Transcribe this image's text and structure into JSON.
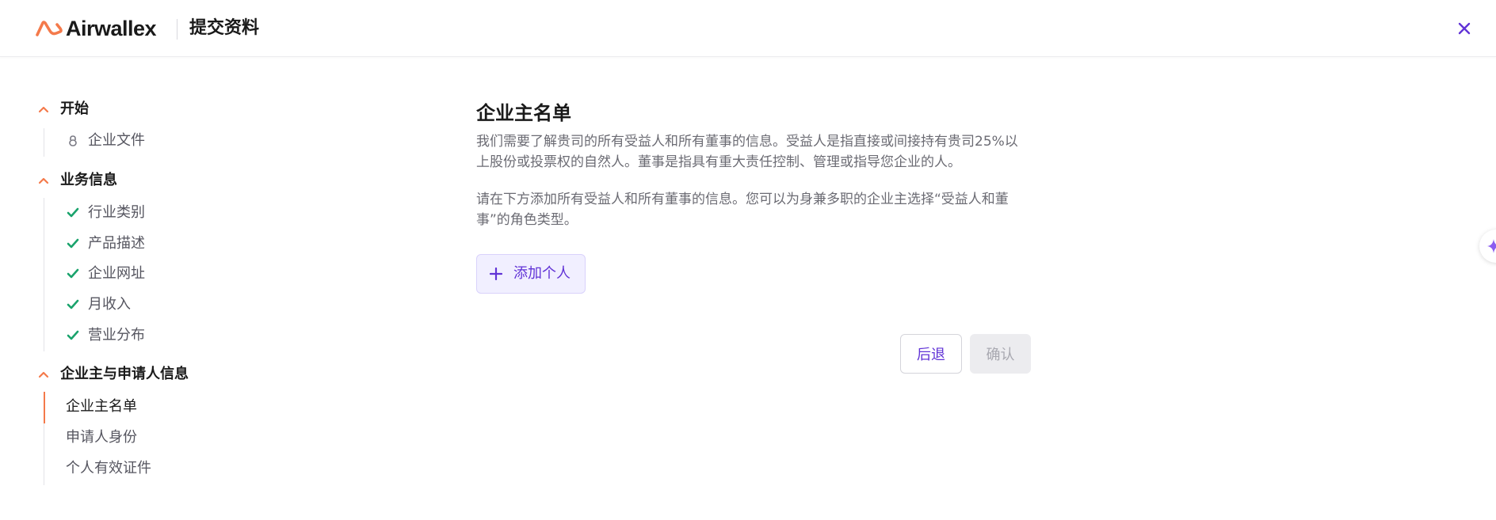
{
  "header": {
    "brand": "Airwallex",
    "title": "提交资料"
  },
  "sidebar": {
    "sections": [
      {
        "label": "开始",
        "items": [
          {
            "label": "企业文件",
            "state": "locked"
          }
        ]
      },
      {
        "label": "业务信息",
        "items": [
          {
            "label": "行业类别",
            "state": "done"
          },
          {
            "label": "产品描述",
            "state": "done"
          },
          {
            "label": "企业网址",
            "state": "done"
          },
          {
            "label": "月收入",
            "state": "done"
          },
          {
            "label": "营业分布",
            "state": "done"
          }
        ]
      },
      {
        "label": "企业主与申请人信息",
        "items": [
          {
            "label": "企业主名单",
            "state": "current"
          },
          {
            "label": "申请人身份",
            "state": "pending"
          },
          {
            "label": "个人有效证件",
            "state": "pending"
          }
        ]
      }
    ]
  },
  "main": {
    "title": "企业主名单",
    "paragraph1": "我们需要了解贵司的所有受益人和所有董事的信息。受益人是指直接或间接持有贵司25%以上股份或投票权的自然人。董事是指具有重大责任控制、管理或指导您企业的人。",
    "paragraph2": "请在下方添加所有受益人和所有董事的信息。您可以为身兼多职的企业主选择“受益人和董事”的角色类型。",
    "add_button": "添加个人",
    "back_button": "后退",
    "confirm_button": "确认"
  },
  "colors": {
    "accent": "#6133d6",
    "brand_orange": "#f47a4b",
    "check_green": "#1aa36c"
  }
}
